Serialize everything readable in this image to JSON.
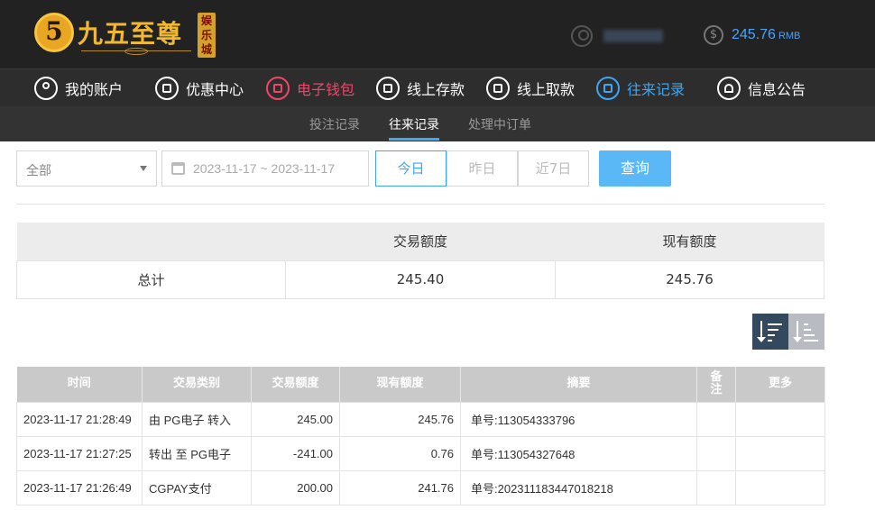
{
  "brand": {
    "name": "九五至尊",
    "seal": "娱乐城",
    "mark": "5"
  },
  "account": {
    "balance": "245.76",
    "currency": "RMB"
  },
  "nav": [
    {
      "label": "我的账户",
      "icon": "user-icon"
    },
    {
      "label": "优惠中心",
      "icon": "gift-icon"
    },
    {
      "label": "电子钱包",
      "icon": "wallet-icon"
    },
    {
      "label": "线上存款",
      "icon": "deposit-icon"
    },
    {
      "label": "线上取款",
      "icon": "withdraw-icon"
    },
    {
      "label": "往来记录",
      "icon": "records-icon"
    },
    {
      "label": "信息公告",
      "icon": "bell-icon"
    }
  ],
  "subnav": [
    {
      "label": "投注记录"
    },
    {
      "label": "往来记录"
    },
    {
      "label": "处理中订单"
    }
  ],
  "filters": {
    "type_value": "全部",
    "date_range": "2023-11-17 ~ 2023-11-17",
    "range_buttons": [
      "今日",
      "昨日",
      "近7日"
    ],
    "query_label": "查询"
  },
  "summary": {
    "headers": [
      "",
      "交易额度",
      "现有额度"
    ],
    "row": [
      "总计",
      "245.40",
      "245.76"
    ]
  },
  "transactions": {
    "headers": [
      "时间",
      "交易类别",
      "交易额度",
      "现有额度",
      "摘要",
      "备注",
      "更多"
    ],
    "rows": [
      [
        "2023-11-17 21:28:49",
        "由 PG电子 转入",
        "245.00",
        "245.76",
        "单号:113054333796",
        "",
        ""
      ],
      [
        "2023-11-17 21:27:25",
        "转出 至 PG电子",
        "-241.00",
        "0.76",
        "单号:113054327648",
        "",
        ""
      ],
      [
        "2023-11-17 21:26:49",
        "CGPAY支付",
        "200.00",
        "241.76",
        "单号:202311183447018218",
        "",
        ""
      ]
    ]
  },
  "colors": {
    "accent_blue": "#3ea6f5",
    "wallet_red": "#f0466a",
    "header_bg": "#222222",
    "brand_gold": "#f2b930"
  }
}
